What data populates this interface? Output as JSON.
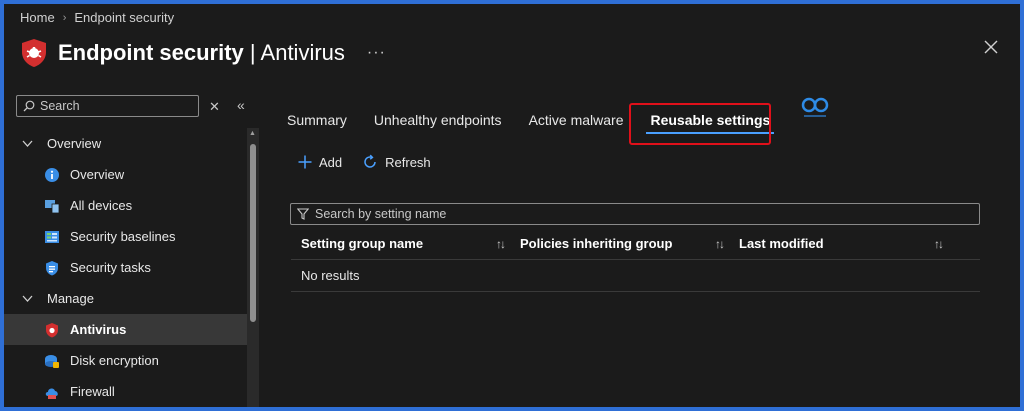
{
  "breadcrumb": {
    "home": "Home",
    "current": "Endpoint security"
  },
  "header": {
    "title": "Endpoint security",
    "separator": " | ",
    "subtitle": "Antivirus",
    "more": "···"
  },
  "sidebar": {
    "search_placeholder": "Search",
    "groups": [
      {
        "label": "Overview",
        "items": [
          {
            "label": "Overview",
            "icon": "info-icon"
          },
          {
            "label": "All devices",
            "icon": "devices-icon"
          },
          {
            "label": "Security baselines",
            "icon": "baselines-icon"
          },
          {
            "label": "Security tasks",
            "icon": "tasks-icon"
          }
        ]
      },
      {
        "label": "Manage",
        "items": [
          {
            "label": "Antivirus",
            "icon": "antivirus-icon",
            "active": true
          },
          {
            "label": "Disk encryption",
            "icon": "disk-encryption-icon"
          },
          {
            "label": "Firewall",
            "icon": "firewall-icon"
          }
        ]
      }
    ]
  },
  "tabs": [
    {
      "label": "Summary"
    },
    {
      "label": "Unhealthy endpoints"
    },
    {
      "label": "Active malware"
    },
    {
      "label": "Reusable settings",
      "selected": true
    }
  ],
  "toolbar": {
    "add_label": "Add",
    "refresh_label": "Refresh"
  },
  "filter": {
    "placeholder": "Search by setting name"
  },
  "table": {
    "columns": [
      "Setting group name",
      "Policies inheriting group",
      "Last modified"
    ],
    "sort_glyph": "↑↓",
    "empty_text": "No results"
  },
  "colors": {
    "accent": "#4aa0ff",
    "highlight": "#e0101a",
    "frame": "#2f6fd6",
    "background": "#1b1b1b"
  }
}
